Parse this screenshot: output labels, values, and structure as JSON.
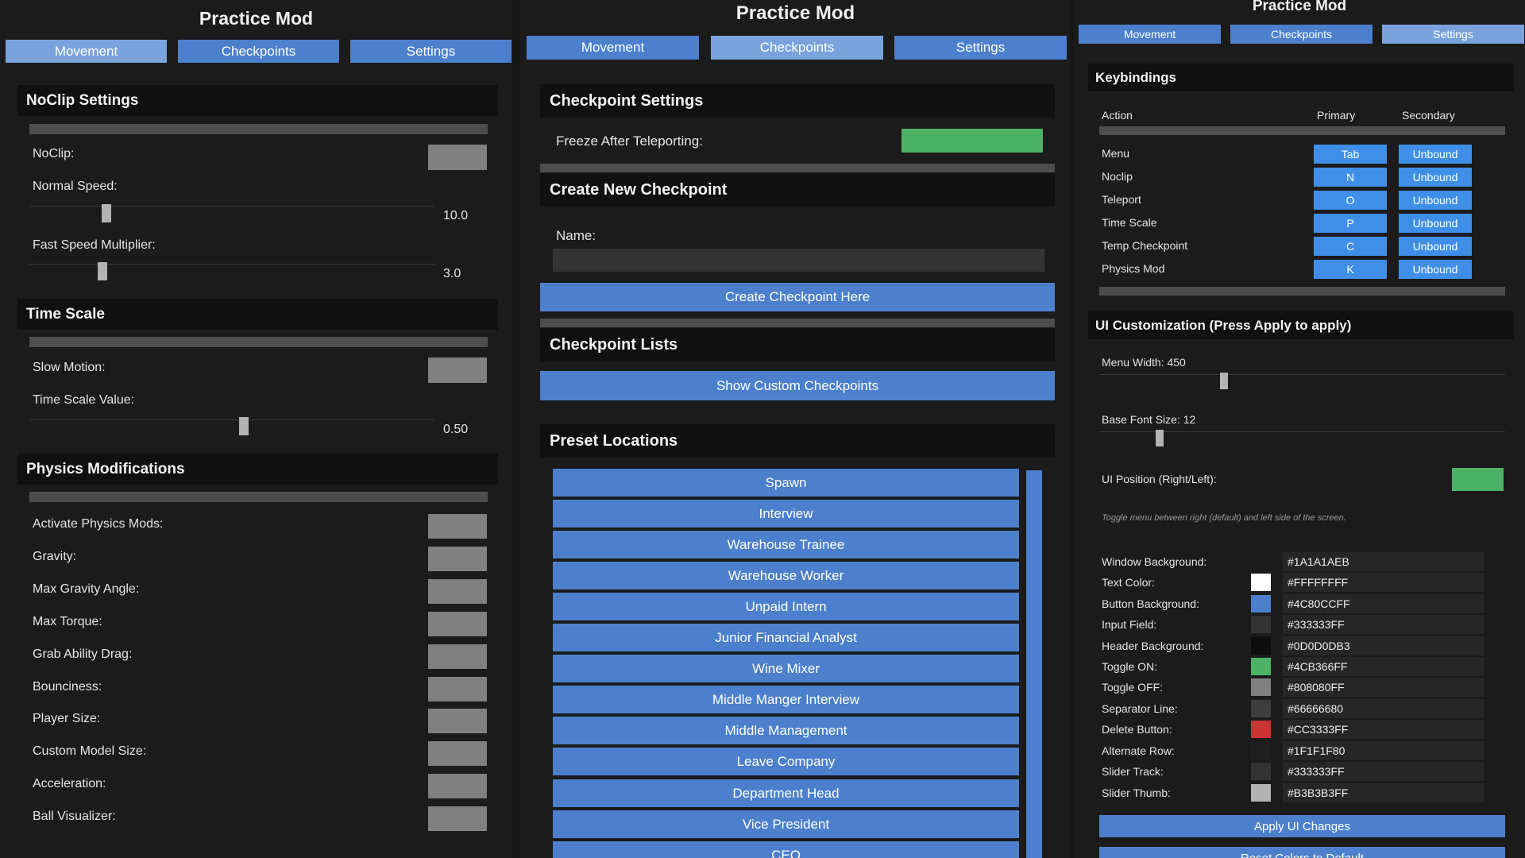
{
  "app_title": "Practice Mod",
  "tabs": [
    "Movement",
    "Checkpoints",
    "Settings"
  ],
  "movement": {
    "noclip_header": "NoClip Settings",
    "noclip_label": "NoClip:",
    "normal_speed_label": "Normal Speed:",
    "normal_speed_value": "10.0",
    "fast_speed_label": "Fast Speed Multiplier:",
    "fast_speed_value": "3.0",
    "timescale_header": "Time Scale",
    "slow_motion_label": "Slow Motion:",
    "timescale_value_label": "Time Scale Value:",
    "timescale_value": "0.50",
    "physics_header": "Physics Modifications",
    "physics_items": [
      "Activate Physics Mods:",
      "Gravity:",
      "Max Gravity Angle:",
      "Max Torque:",
      "Grab Ability Drag:",
      "Bounciness:",
      "Player Size:",
      "Custom Model Size:",
      "Acceleration:",
      "Ball Visualizer:"
    ]
  },
  "checkpoints": {
    "settings_header": "Checkpoint Settings",
    "freeze_label": "Freeze After Teleporting:",
    "create_header": "Create New Checkpoint",
    "name_label": "Name:",
    "name_value": "",
    "create_button": "Create Checkpoint Here",
    "lists_header": "Checkpoint Lists",
    "show_custom_button": "Show Custom Checkpoints",
    "preset_header": "Preset Locations",
    "presets": [
      "Spawn",
      "Interview",
      "Warehouse Trainee",
      "Warehouse Worker",
      "Unpaid Intern",
      "Junior Financial Analyst",
      "Wine Mixer",
      "Middle Manger Interview",
      "Middle Management",
      "Leave Company",
      "Department Head",
      "Vice President",
      "CEO"
    ]
  },
  "settings": {
    "keybindings_header": "Keybindings",
    "col_action": "Action",
    "col_primary": "Primary",
    "col_secondary": "Secondary",
    "bindings": [
      {
        "action": "Menu",
        "primary": "Tab",
        "secondary": "Unbound"
      },
      {
        "action": "Noclip",
        "primary": "N",
        "secondary": "Unbound"
      },
      {
        "action": "Teleport",
        "primary": "O",
        "secondary": "Unbound"
      },
      {
        "action": "Time Scale",
        "primary": "P",
        "secondary": "Unbound"
      },
      {
        "action": "Temp Checkpoint",
        "primary": "C",
        "secondary": "Unbound"
      },
      {
        "action": "Physics Mod",
        "primary": "K",
        "secondary": "Unbound"
      }
    ],
    "ui_header": "UI Customization (Press Apply to apply)",
    "menu_width_label": "Menu Width: 450",
    "font_size_label": "Base Font Size: 12",
    "ui_position_label": "UI Position (Right/Left):",
    "ui_position_hint": "Toggle menu between right (default) and left side of the screen.",
    "colors": [
      {
        "label": "Window Background:",
        "hex": "#1A1A1AEB",
        "swatch": "#1a1a1a"
      },
      {
        "label": "Text Color:",
        "hex": "#FFFFFFFF",
        "swatch": "#ffffff"
      },
      {
        "label": "Button Background:",
        "hex": "#4C80CCFF",
        "swatch": "#4c80cc"
      },
      {
        "label": "Input Field:",
        "hex": "#333333FF",
        "swatch": "#333333"
      },
      {
        "label": "Header Background:",
        "hex": "#0D0D0DB3",
        "swatch": "#0d0d0d"
      },
      {
        "label": "Toggle ON:",
        "hex": "#4CB366FF",
        "swatch": "#4cb366"
      },
      {
        "label": "Toggle OFF:",
        "hex": "#808080FF",
        "swatch": "#808080"
      },
      {
        "label": "Separator Line:",
        "hex": "#66666680",
        "swatch": "#3d3d3d"
      },
      {
        "label": "Delete Button:",
        "hex": "#CC3333FF",
        "swatch": "#cc3333"
      },
      {
        "label": "Alternate Row:",
        "hex": "#1F1F1F80",
        "swatch": "#1f1f1f"
      },
      {
        "label": "Slider Track:",
        "hex": "#333333FF",
        "swatch": "#333333"
      },
      {
        "label": "Slider Thumb:",
        "hex": "#B3B3B3FF",
        "swatch": "#b3b3b3"
      }
    ],
    "apply_button": "Apply UI Changes",
    "reset_button": "Reset Colors to Default"
  }
}
